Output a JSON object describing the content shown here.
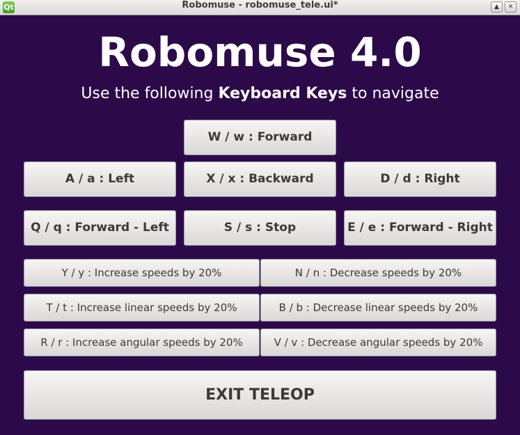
{
  "window": {
    "title": "Robomuse - robomuse_tele.ui*",
    "icon_label": "Qt",
    "maximize_glyph": "▲",
    "close_glyph": "✕"
  },
  "header": {
    "title": "Robomuse 4.0",
    "subtitle_prefix": "Use the following ",
    "subtitle_bold": "Keyboard Keys",
    "subtitle_suffix": " to navigate"
  },
  "buttons": {
    "forward": "W / w : Forward",
    "left": "A / a : Left",
    "backward": "X / x : Backward",
    "right": "D / d : Right",
    "forward_left": "Q / q : Forward - Left",
    "stop": "S / s : Stop",
    "forward_right": "E / e : Forward - Right",
    "increase_speed": "Y / y : Increase speeds by 20%",
    "decrease_speed": "N / n : Decrease speeds by 20%",
    "increase_linear": "T / t : Increase linear speeds by 20%",
    "decrease_linear": "B / b : Decrease linear speeds by 20%",
    "increase_angular": "R / r : Increase angular speeds by 20%",
    "decrease_angular": "V / v : Decrease angular speeds by 20%",
    "exit": "EXIT TELEOP"
  },
  "colors": {
    "background": "#2c0a4a",
    "button_text": "#3a3a3a",
    "heading_text": "#ffffff"
  }
}
